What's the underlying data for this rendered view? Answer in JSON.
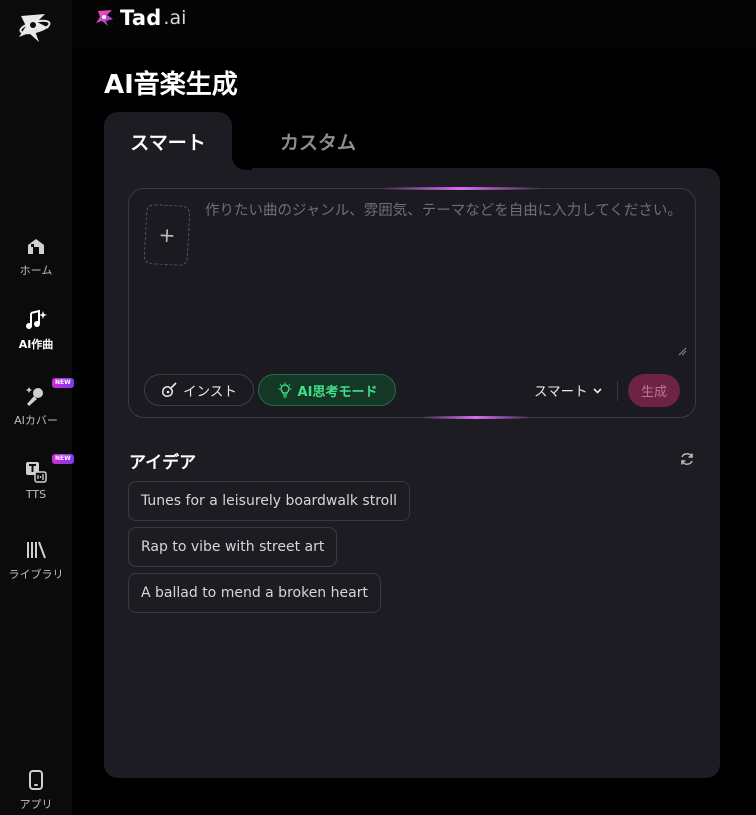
{
  "brand": {
    "name": "Tad",
    "suffix": ".ai"
  },
  "sidebar": {
    "items": [
      {
        "label": "ホーム",
        "icon": "home-icon"
      },
      {
        "label": "AI作曲",
        "icon": "music-sparkle-icon",
        "active": true
      },
      {
        "label": "AIカバー",
        "icon": "microphone-sparkle-icon",
        "badge": "NEW"
      },
      {
        "label": "TTS",
        "icon": "text-to-speech-icon",
        "badge": "NEW"
      },
      {
        "label": "ライブラリ",
        "icon": "library-icon"
      }
    ],
    "app_label": "アプリ",
    "app_icon": "phone-icon"
  },
  "page": {
    "title": "AI音楽生成"
  },
  "tabs": {
    "smart": "スマート",
    "custom": "カスタム"
  },
  "composer": {
    "placeholder": "作りたい曲のジャンル、雰囲気、テーマなどを自由に入力してください。",
    "upload_symbol": "+",
    "inst_label": "インスト",
    "ai_mode_label": "AI思考モード",
    "mode_value": "スマート",
    "generate_label": "生成",
    "accent_colors": {
      "ai_mode": "#3ee08a",
      "generate": "#6e2345",
      "glow": "#d66ef0"
    }
  },
  "ideas": {
    "title": "アイデア",
    "items": [
      "Tunes for a leisurely boardwalk stroll",
      "Rap to vibe with street art",
      "A ballad to mend a broken heart"
    ]
  }
}
